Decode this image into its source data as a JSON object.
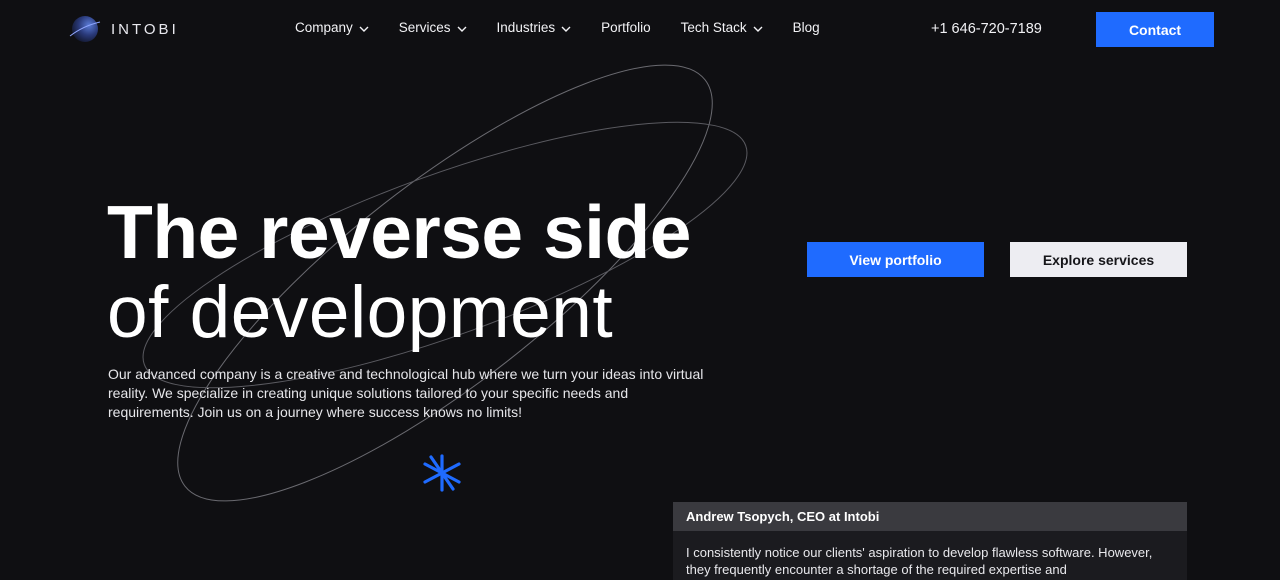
{
  "brand": {
    "name": "INTOBI",
    "accent_color": "#1f6bff",
    "background_color": "#0f0f12"
  },
  "nav": {
    "items": [
      {
        "label": "Company",
        "has_dropdown": true
      },
      {
        "label": "Services",
        "has_dropdown": true
      },
      {
        "label": "Industries",
        "has_dropdown": true
      },
      {
        "label": "Portfolio",
        "has_dropdown": false
      },
      {
        "label": "Tech Stack",
        "has_dropdown": true
      },
      {
        "label": "Blog",
        "has_dropdown": false
      }
    ],
    "dropdown_icon": "chevron-down-icon"
  },
  "header": {
    "phone": "+1 646-720-7189",
    "contact_label": "Contact"
  },
  "hero": {
    "title_line1": "The reverse side",
    "title_line2": "of development",
    "description": "Our advanced company is a creative and technological hub where we turn your ideas into virtual reality. We specialize in creating unique solutions tailored to your specific needs and requirements. Join us on a journey where success knows no limits!",
    "primary_button": "View portfolio",
    "secondary_button": "Explore services",
    "decoration_icon": "asterisk-icon"
  },
  "testimonial": {
    "author": "Andrew Tsopych, CEO at Intobi",
    "quote": "I consistently notice our clients' aspiration to develop flawless software. However, they frequently encounter a shortage of the required expertise and"
  }
}
